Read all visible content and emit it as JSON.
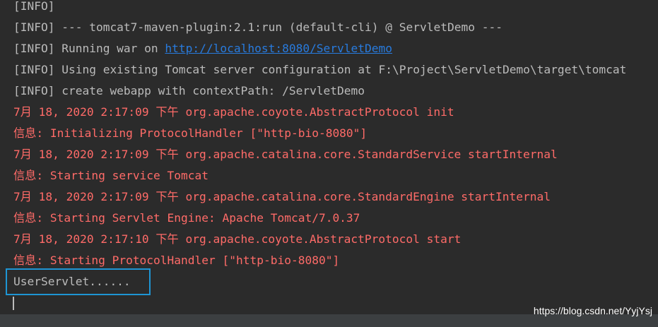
{
  "console": {
    "lines": [
      {
        "kind": "info",
        "text": "[INFO]"
      },
      {
        "kind": "info",
        "text": "[INFO] --- tomcat7-maven-plugin:2.1:run (default-cli) @ ServletDemo ---"
      },
      {
        "kind": "info",
        "text": "[INFO] Running war on ",
        "link": "http://localhost:8080/ServletDemo"
      },
      {
        "kind": "info",
        "text": "[INFO] Using existing Tomcat server configuration at F:\\Project\\ServletDemo\\target\\tomcat"
      },
      {
        "kind": "info",
        "text": "[INFO] create webapp with contextPath: /ServletDemo"
      },
      {
        "kind": "err",
        "text": "7月 18, 2020 2:17:09 下午 org.apache.coyote.AbstractProtocol init"
      },
      {
        "kind": "err",
        "text": "信息: Initializing ProtocolHandler [\"http-bio-8080\"]"
      },
      {
        "kind": "err",
        "text": "7月 18, 2020 2:17:09 下午 org.apache.catalina.core.StandardService startInternal"
      },
      {
        "kind": "err",
        "text": "信息: Starting service Tomcat"
      },
      {
        "kind": "err",
        "text": "7月 18, 2020 2:17:09 下午 org.apache.catalina.core.StandardEngine startInternal"
      },
      {
        "kind": "err",
        "text": "信息: Starting Servlet Engine: Apache Tomcat/7.0.37"
      },
      {
        "kind": "err",
        "text": "7月 18, 2020 2:17:10 下午 org.apache.coyote.AbstractProtocol start"
      },
      {
        "kind": "err",
        "text": "信息: Starting ProtocolHandler [\"http-bio-8080\"]"
      },
      {
        "kind": "info",
        "text": "UserServlet......"
      }
    ]
  },
  "watermark": "https://blog.csdn.net/YyjYsj",
  "colors": {
    "background": "#2b2b2b",
    "info_text": "#bbbbbb",
    "error_text": "#ff6b68",
    "link": "#287bde",
    "highlight_border": "#1e95d4"
  }
}
